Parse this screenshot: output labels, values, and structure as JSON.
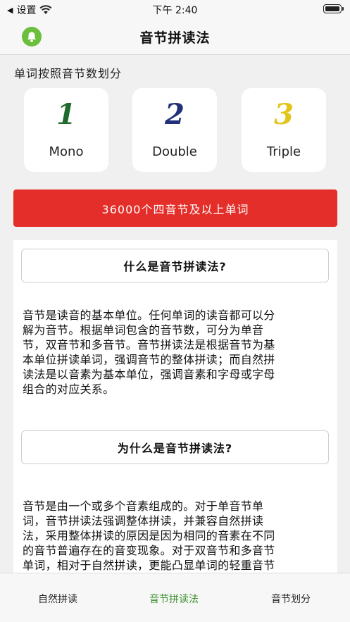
{
  "status_bar": {
    "back_label": "设置",
    "time": "下午 2:40"
  },
  "nav": {
    "title": "音节拼读法",
    "icon": "bell-icon",
    "accent": "#6bbf3d"
  },
  "section_label": "单词按照音节数划分",
  "cards": [
    {
      "number": "1",
      "label": "Mono",
      "color": "#1f6b2e"
    },
    {
      "number": "2",
      "label": "Double",
      "color": "#22307a"
    },
    {
      "number": "3",
      "label": "Triple",
      "color": "#e2c51a"
    }
  ],
  "banner": {
    "label": "36000个四音节及以上单词",
    "color": "#e32e2a"
  },
  "faq": [
    {
      "question": "什么是音节拼读法?",
      "lines": [
        "音节是读音的基本单位。任何单词的读音都可以分",
        "解为音节。根据单词包含的音节数，可分为单音",
        "节，双音节和多音节。音节拼读法是根据音节为基",
        "本单位拼读单词，强调音节的整体拼读；而自然拼",
        "读法是以音素为基本单位，强调音素和字母或字母",
        "组合的对应关系。"
      ]
    },
    {
      "question": "为什么是音节拼读法?",
      "lines": [
        "音节是由一个或多个音素组成的。对于单音节单",
        "词，音节拼读法强调整体拼读，并兼容自然拼读",
        "法，采用整体拼读的原因是因为相同的音素在不同",
        "的音节普遍存在的音变现象。对于双音节和多音节",
        "单词，相对于自然拼读，更能凸显单词的轻重音节"
      ]
    }
  ],
  "tabs": [
    {
      "label": "自然拼读",
      "active": false
    },
    {
      "label": "音节拼读法",
      "active": true
    },
    {
      "label": "音节划分",
      "active": false
    }
  ]
}
